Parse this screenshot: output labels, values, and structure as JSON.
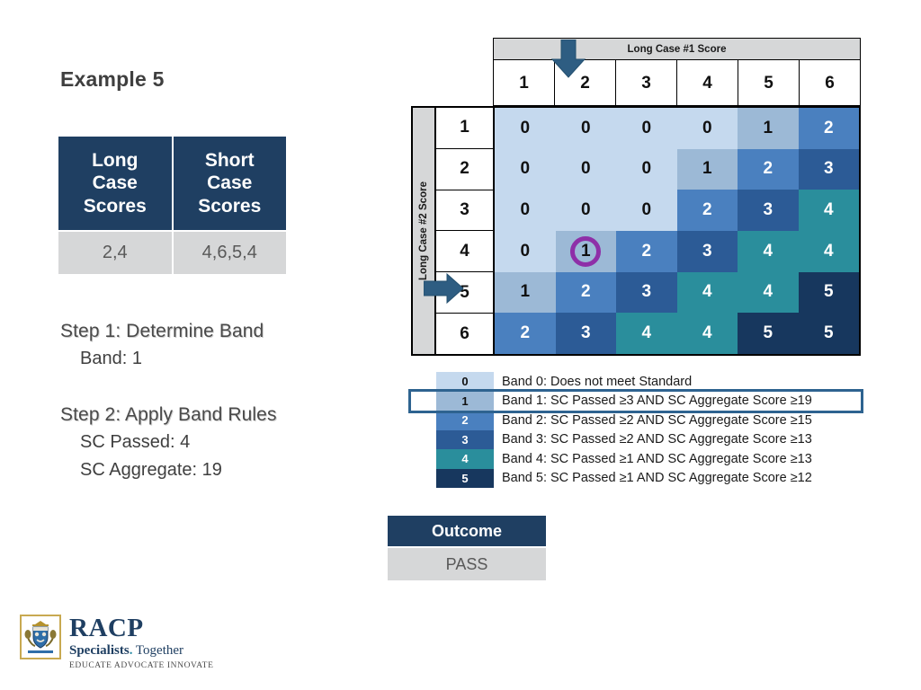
{
  "slide": {
    "title": "Example 5"
  },
  "scores_table": {
    "headers": [
      "Long Case Scores",
      "Short Case Scores"
    ],
    "header_lines": [
      [
        "Long",
        "Case",
        "Scores"
      ],
      [
        "Short",
        "Case",
        "Scores"
      ]
    ],
    "values": [
      "2,4",
      "4,6,5,4"
    ]
  },
  "steps": [
    {
      "heading": "Step 1: Determine Band",
      "lines": [
        "Band: 1"
      ]
    },
    {
      "heading": "Step 2: Apply Band Rules",
      "lines": [
        "SC Passed: 4",
        "SC Aggregate: 19"
      ]
    }
  ],
  "matrix": {
    "column_axis_title": "Long Case #1 Score",
    "row_axis_title": "Long Case #2 Score",
    "column_labels": [
      "1",
      "2",
      "3",
      "4",
      "5",
      "6"
    ],
    "row_labels": [
      "1",
      "2",
      "3",
      "4",
      "5",
      "6"
    ],
    "highlight_column": "2",
    "highlight_row": "4",
    "highlighted_cell": {
      "row": "4",
      "column": "2",
      "value": "1"
    },
    "values": [
      [
        0,
        0,
        0,
        0,
        1,
        2
      ],
      [
        0,
        0,
        0,
        1,
        2,
        3
      ],
      [
        0,
        0,
        0,
        2,
        3,
        4
      ],
      [
        0,
        1,
        2,
        3,
        4,
        4
      ],
      [
        1,
        2,
        3,
        4,
        4,
        5
      ],
      [
        2,
        3,
        4,
        4,
        5,
        5
      ]
    ]
  },
  "band_colors": {
    "0": "#c5d9ee",
    "1": "#9cb9d6",
    "2": "#4a80bf",
    "3": "#2c5b96",
    "4": "#2a8e9c",
    "5": "#17375e"
  },
  "band_text_colors": {
    "0": "#111111",
    "1": "#111111",
    "2": "#ffffff",
    "3": "#ffffff",
    "4": "#ffffff",
    "5": "#ffffff"
  },
  "legend": {
    "highlighted_band": "1",
    "rows": [
      {
        "band": "0",
        "text": "Band 0: Does not meet Standard"
      },
      {
        "band": "1",
        "text": "Band 1: SC Passed ≥3 AND SC Aggregate Score ≥19"
      },
      {
        "band": "2",
        "text": "Band 2: SC Passed ≥2 AND SC Aggregate Score ≥15"
      },
      {
        "band": "3",
        "text": "Band 3: SC Passed ≥2 AND SC Aggregate Score ≥13"
      },
      {
        "band": "4",
        "text": "Band 4: SC Passed ≥1 AND SC Aggregate Score ≥13"
      },
      {
        "band": "5",
        "text": "Band 5: SC Passed ≥1 AND SC Aggregate Score ≥12"
      }
    ]
  },
  "outcome": {
    "label": "Outcome",
    "value": "PASS"
  },
  "logo": {
    "name": "RACP",
    "tagline_bold": "Specialists",
    "tagline_dot": ".",
    "tagline_rest": " Together",
    "subtitle": "EDUCATE  ADVOCATE  INNOVATE"
  },
  "colors": {
    "brand_navy": "#1f3f62",
    "gray_fill": "#d6d7d8",
    "highlight_purple": "#8e2fa8",
    "arrow_blue": "#2e5d82",
    "legend_outline": "#2e6390"
  }
}
